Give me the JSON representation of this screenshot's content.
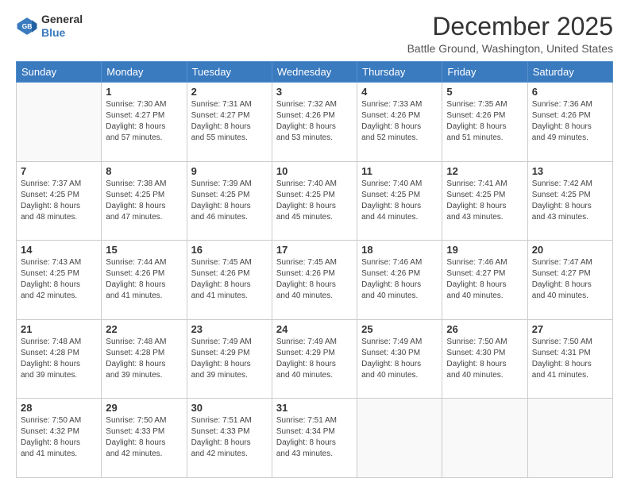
{
  "logo": {
    "general": "General",
    "blue": "Blue"
  },
  "header": {
    "title": "December 2025",
    "subtitle": "Battle Ground, Washington, United States"
  },
  "days_of_week": [
    "Sunday",
    "Monday",
    "Tuesday",
    "Wednesday",
    "Thursday",
    "Friday",
    "Saturday"
  ],
  "weeks": [
    [
      {
        "day": "",
        "info": ""
      },
      {
        "day": "1",
        "info": "Sunrise: 7:30 AM\nSunset: 4:27 PM\nDaylight: 8 hours\nand 57 minutes."
      },
      {
        "day": "2",
        "info": "Sunrise: 7:31 AM\nSunset: 4:27 PM\nDaylight: 8 hours\nand 55 minutes."
      },
      {
        "day": "3",
        "info": "Sunrise: 7:32 AM\nSunset: 4:26 PM\nDaylight: 8 hours\nand 53 minutes."
      },
      {
        "day": "4",
        "info": "Sunrise: 7:33 AM\nSunset: 4:26 PM\nDaylight: 8 hours\nand 52 minutes."
      },
      {
        "day": "5",
        "info": "Sunrise: 7:35 AM\nSunset: 4:26 PM\nDaylight: 8 hours\nand 51 minutes."
      },
      {
        "day": "6",
        "info": "Sunrise: 7:36 AM\nSunset: 4:26 PM\nDaylight: 8 hours\nand 49 minutes."
      }
    ],
    [
      {
        "day": "7",
        "info": "Sunrise: 7:37 AM\nSunset: 4:25 PM\nDaylight: 8 hours\nand 48 minutes."
      },
      {
        "day": "8",
        "info": "Sunrise: 7:38 AM\nSunset: 4:25 PM\nDaylight: 8 hours\nand 47 minutes."
      },
      {
        "day": "9",
        "info": "Sunrise: 7:39 AM\nSunset: 4:25 PM\nDaylight: 8 hours\nand 46 minutes."
      },
      {
        "day": "10",
        "info": "Sunrise: 7:40 AM\nSunset: 4:25 PM\nDaylight: 8 hours\nand 45 minutes."
      },
      {
        "day": "11",
        "info": "Sunrise: 7:40 AM\nSunset: 4:25 PM\nDaylight: 8 hours\nand 44 minutes."
      },
      {
        "day": "12",
        "info": "Sunrise: 7:41 AM\nSunset: 4:25 PM\nDaylight: 8 hours\nand 43 minutes."
      },
      {
        "day": "13",
        "info": "Sunrise: 7:42 AM\nSunset: 4:25 PM\nDaylight: 8 hours\nand 43 minutes."
      }
    ],
    [
      {
        "day": "14",
        "info": "Sunrise: 7:43 AM\nSunset: 4:25 PM\nDaylight: 8 hours\nand 42 minutes."
      },
      {
        "day": "15",
        "info": "Sunrise: 7:44 AM\nSunset: 4:26 PM\nDaylight: 8 hours\nand 41 minutes."
      },
      {
        "day": "16",
        "info": "Sunrise: 7:45 AM\nSunset: 4:26 PM\nDaylight: 8 hours\nand 41 minutes."
      },
      {
        "day": "17",
        "info": "Sunrise: 7:45 AM\nSunset: 4:26 PM\nDaylight: 8 hours\nand 40 minutes."
      },
      {
        "day": "18",
        "info": "Sunrise: 7:46 AM\nSunset: 4:26 PM\nDaylight: 8 hours\nand 40 minutes."
      },
      {
        "day": "19",
        "info": "Sunrise: 7:46 AM\nSunset: 4:27 PM\nDaylight: 8 hours\nand 40 minutes."
      },
      {
        "day": "20",
        "info": "Sunrise: 7:47 AM\nSunset: 4:27 PM\nDaylight: 8 hours\nand 40 minutes."
      }
    ],
    [
      {
        "day": "21",
        "info": "Sunrise: 7:48 AM\nSunset: 4:28 PM\nDaylight: 8 hours\nand 39 minutes."
      },
      {
        "day": "22",
        "info": "Sunrise: 7:48 AM\nSunset: 4:28 PM\nDaylight: 8 hours\nand 39 minutes."
      },
      {
        "day": "23",
        "info": "Sunrise: 7:49 AM\nSunset: 4:29 PM\nDaylight: 8 hours\nand 39 minutes."
      },
      {
        "day": "24",
        "info": "Sunrise: 7:49 AM\nSunset: 4:29 PM\nDaylight: 8 hours\nand 40 minutes."
      },
      {
        "day": "25",
        "info": "Sunrise: 7:49 AM\nSunset: 4:30 PM\nDaylight: 8 hours\nand 40 minutes."
      },
      {
        "day": "26",
        "info": "Sunrise: 7:50 AM\nSunset: 4:30 PM\nDaylight: 8 hours\nand 40 minutes."
      },
      {
        "day": "27",
        "info": "Sunrise: 7:50 AM\nSunset: 4:31 PM\nDaylight: 8 hours\nand 41 minutes."
      }
    ],
    [
      {
        "day": "28",
        "info": "Sunrise: 7:50 AM\nSunset: 4:32 PM\nDaylight: 8 hours\nand 41 minutes."
      },
      {
        "day": "29",
        "info": "Sunrise: 7:50 AM\nSunset: 4:33 PM\nDaylight: 8 hours\nand 42 minutes."
      },
      {
        "day": "30",
        "info": "Sunrise: 7:51 AM\nSunset: 4:33 PM\nDaylight: 8 hours\nand 42 minutes."
      },
      {
        "day": "31",
        "info": "Sunrise: 7:51 AM\nSunset: 4:34 PM\nDaylight: 8 hours\nand 43 minutes."
      },
      {
        "day": "",
        "info": ""
      },
      {
        "day": "",
        "info": ""
      },
      {
        "day": "",
        "info": ""
      }
    ]
  ]
}
